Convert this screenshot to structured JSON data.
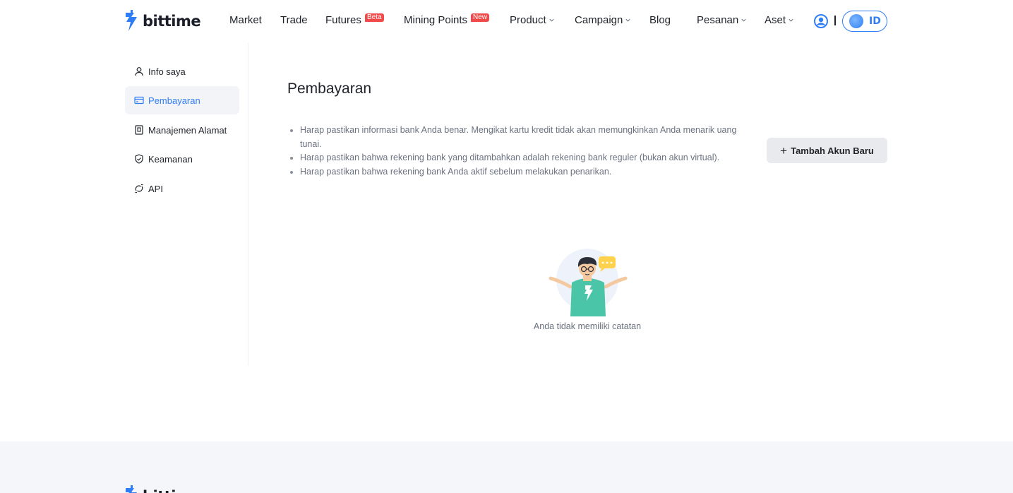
{
  "brand": {
    "name": "bittime",
    "accent": "#2f7ef5",
    "badge_color": "#f04a4a"
  },
  "nav": {
    "market": "Market",
    "trade": "Trade",
    "futures": "Futures",
    "futures_badge": "Beta",
    "mining": "Mining Points",
    "mining_badge": "New",
    "product": "Product",
    "campaign": "Campaign",
    "blog": "Blog",
    "orders": "Pesanan",
    "assets": "Aset",
    "language": "ID"
  },
  "sidebar": {
    "items": [
      {
        "label": "Info saya",
        "icon": "user-icon"
      },
      {
        "label": "Pembayaran",
        "icon": "card-icon",
        "active": true
      },
      {
        "label": "Manajemen Alamat",
        "icon": "address-book-icon"
      },
      {
        "label": "Keamanan",
        "icon": "shield-icon"
      },
      {
        "label": "API",
        "icon": "api-icon"
      }
    ]
  },
  "main": {
    "title": "Pembayaran",
    "notes": [
      "Harap pastikan informasi bank Anda benar. Mengikat kartu kredit tidak akan memungkinkan Anda menarik uang tunai.",
      "Harap pastikan bahwa rekening bank yang ditambahkan adalah rekening bank reguler (bukan akun virtual).",
      "Harap pastikan bahwa rekening bank Anda aktif sebelum melakukan penarikan."
    ],
    "add_button": "Tambah Akun Baru",
    "empty_text": "Anda tidak memiliki catatan"
  }
}
